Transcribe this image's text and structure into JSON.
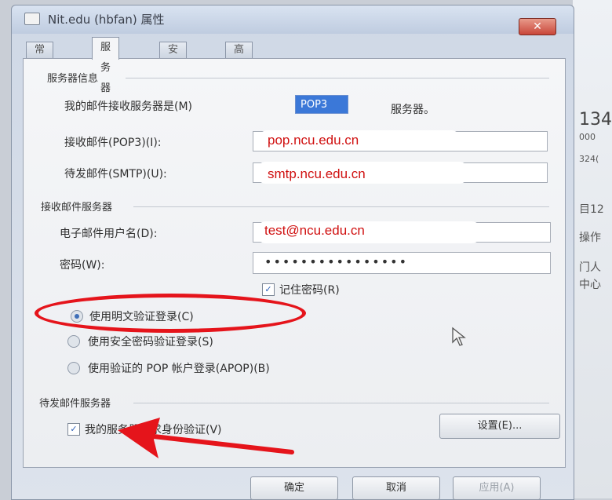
{
  "window": {
    "title": "Nit.edu (hbfan) 属性",
    "close_label": "✕"
  },
  "tabs": [
    {
      "label": "常规"
    },
    {
      "label": "服务器"
    },
    {
      "label": "安全"
    },
    {
      "label": "高级"
    }
  ],
  "server_info": {
    "group_title": "服务器信息",
    "incoming_type_label": "我的邮件接收服务器是(M)",
    "incoming_type_value": "POP3",
    "incoming_type_suffix": "服务器。",
    "pop3_label": "接收邮件(POP3)(I):",
    "pop3_value": "pop.ncu.edu.cn",
    "smtp_label": "待发邮件(SMTP)(U):",
    "smtp_value": "smtp.ncu.edu.cn"
  },
  "incoming_server": {
    "group_title": "接收邮件服务器",
    "username_label": "电子邮件用户名(D):",
    "username_value": "test@ncu.edu.cn",
    "password_label": "密码(W):",
    "password_value": "••••••••••••••••",
    "remember_label": "记住密码(R)",
    "remember_checked": true,
    "auth_options": [
      {
        "label": "使用明文验证登录(C)",
        "checked": true
      },
      {
        "label": "使用安全密码验证登录(S)",
        "checked": false
      },
      {
        "label": "使用验证的 POP 帐户登录(APOP)(B)",
        "checked": false
      }
    ]
  },
  "outgoing_server": {
    "group_title": "待发邮件服务器",
    "auth_required_label": "我的服务器要求身份验证(V)",
    "auth_required_checked": true,
    "settings_label": "设置(E)..."
  },
  "footer": {
    "ok_label": "确定",
    "cancel_label": "取消",
    "apply_label": "应用(A)"
  },
  "background_window": {
    "lines": [
      "134",
      "000",
      "324(",
      "目12",
      "操作",
      "门人",
      "中心"
    ]
  },
  "colors": {
    "annotation_red": "#e5141b",
    "field_text_red": "#d01010",
    "selection_blue": "#3b78d8"
  }
}
